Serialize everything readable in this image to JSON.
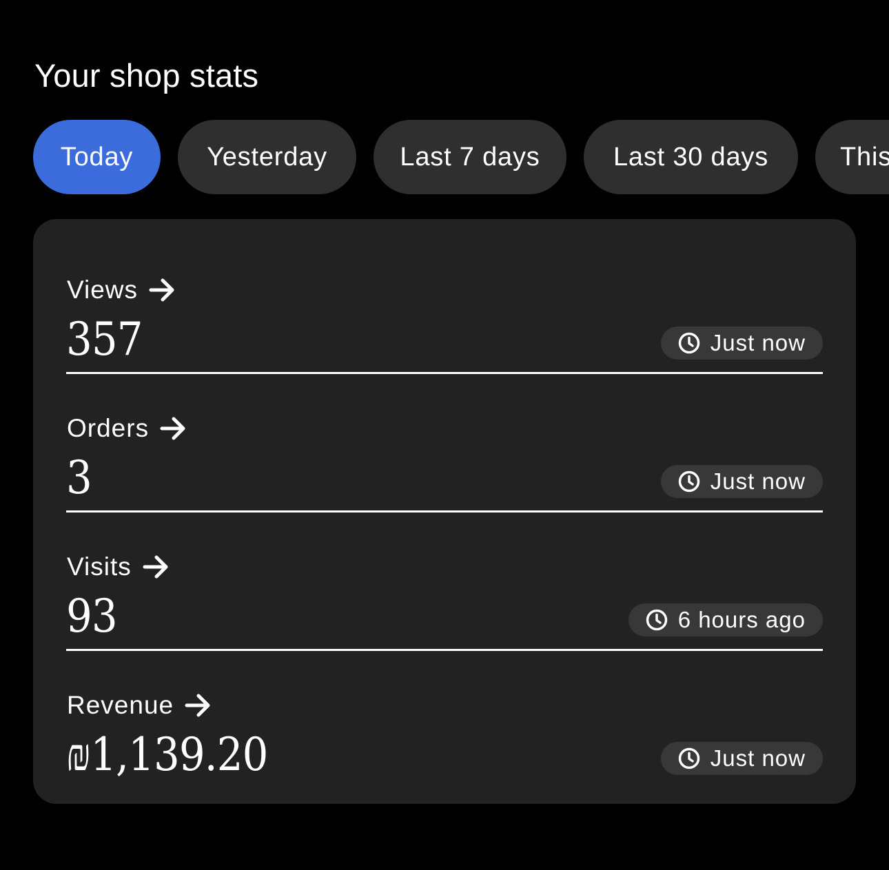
{
  "header": {
    "title": "Your shop stats"
  },
  "filters": {
    "active": "Today",
    "chips": [
      {
        "label": "Today"
      },
      {
        "label": "Yesterday"
      },
      {
        "label": "Last 7 days"
      },
      {
        "label": "Last 30 days"
      },
      {
        "label": "This"
      }
    ]
  },
  "stats": [
    {
      "label": "Views",
      "value": "357",
      "updated": "Just now"
    },
    {
      "label": "Orders",
      "value": "3",
      "updated": "Just now"
    },
    {
      "label": "Visits",
      "value": "93",
      "updated": "6 hours ago"
    },
    {
      "label": "Revenue",
      "value": "₪1,139.20",
      "updated": "Just now"
    }
  ],
  "icons": {
    "stat_arrow": "arrow-right-icon",
    "timestamp": "clock-icon"
  },
  "colors": {
    "background": "#000000",
    "card": "#222222",
    "chip": "#2f2f2f",
    "chip_active": "#3c6bdc",
    "badge": "#383838",
    "text": "#ffffff"
  }
}
